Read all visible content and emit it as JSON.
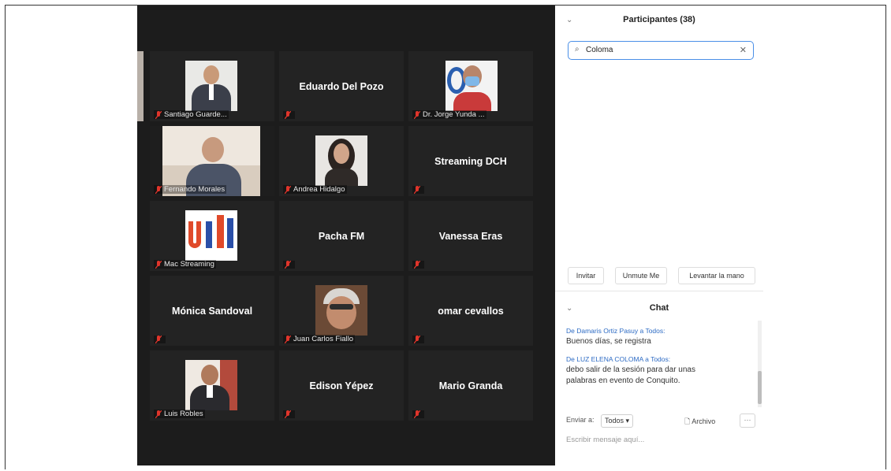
{
  "participants_panel": {
    "title": "Participantes (38)",
    "search_value": "Coloma",
    "buttons": [
      "Invitar",
      "Unmute Me",
      "Levantar la mano"
    ]
  },
  "chat": {
    "title": "Chat",
    "messages": [
      {
        "from": "De Damaris Ortiz Pasuy a Todos:",
        "text": "Buenos días, se registra"
      },
      {
        "from": "De LUZ ELENA COLOMA a Todos:",
        "text": "debo salir de la sesión para dar unas palabras en evento de Conquito."
      }
    ],
    "send_to_label": "Enviar a:",
    "send_to_value": "Todos",
    "file_label": "Archivo",
    "compose_placeholder": "Escribir mensaje aquí..."
  },
  "tiles": [
    {
      "label": "Santiago Guarde...",
      "center": ""
    },
    {
      "label": "",
      "center": "Eduardo Del Pozo"
    },
    {
      "label": "Dr. Jorge Yunda ...",
      "center": ""
    },
    {
      "label": "Fernando Morales",
      "center": ""
    },
    {
      "label": "Andrea Hidalgo",
      "center": ""
    },
    {
      "label": "",
      "center": "Streaming DCH"
    },
    {
      "label": "Mac Streaming",
      "center": ""
    },
    {
      "label": "",
      "center": "Pacha FM"
    },
    {
      "label": "",
      "center": "Vanessa Eras"
    },
    {
      "label": "",
      "center": "Mónica Sandoval"
    },
    {
      "label": "Juan Carlos Fiallo",
      "center": ""
    },
    {
      "label": "",
      "center": "omar cevallos"
    },
    {
      "label": "Luis Robles",
      "center": ""
    },
    {
      "label": "",
      "center": "Edison Yépez"
    },
    {
      "label": "",
      "center": "Mario Granda"
    }
  ],
  "colors": {
    "accent": "#4a8fe7",
    "muted_mic": "#e0352b",
    "gallery_bg": "#1c1c1c"
  }
}
